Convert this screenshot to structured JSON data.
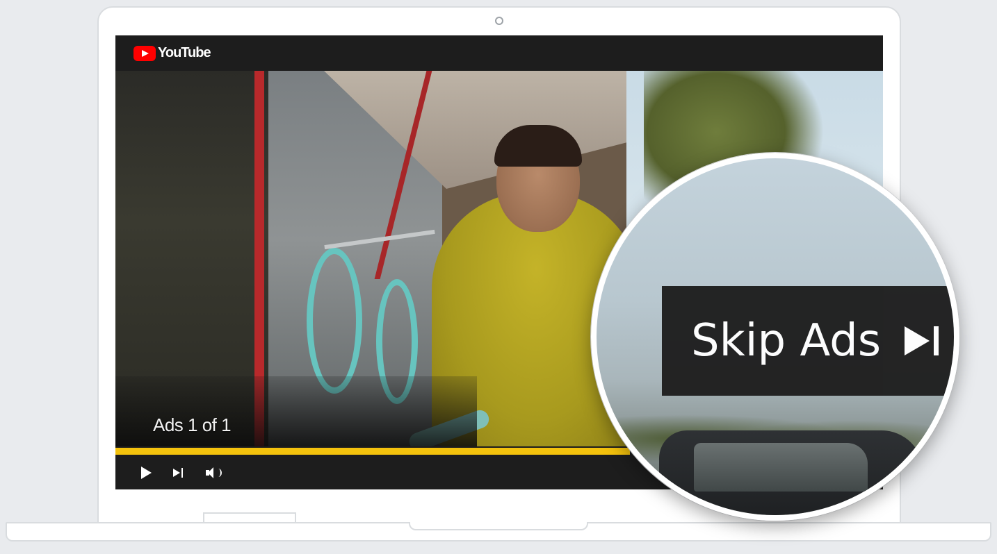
{
  "player": {
    "brand": "YouTube",
    "ad_label": "Ads 1 of 1",
    "progress_fraction": 0.67,
    "accent_color": "#f4c20d",
    "logo_color": "#ff0000"
  },
  "controls": {
    "icons": [
      "play-icon",
      "next-icon",
      "volume-icon"
    ]
  },
  "skip_button": {
    "label": "Skip Ads",
    "icon": "skip-next-icon"
  }
}
